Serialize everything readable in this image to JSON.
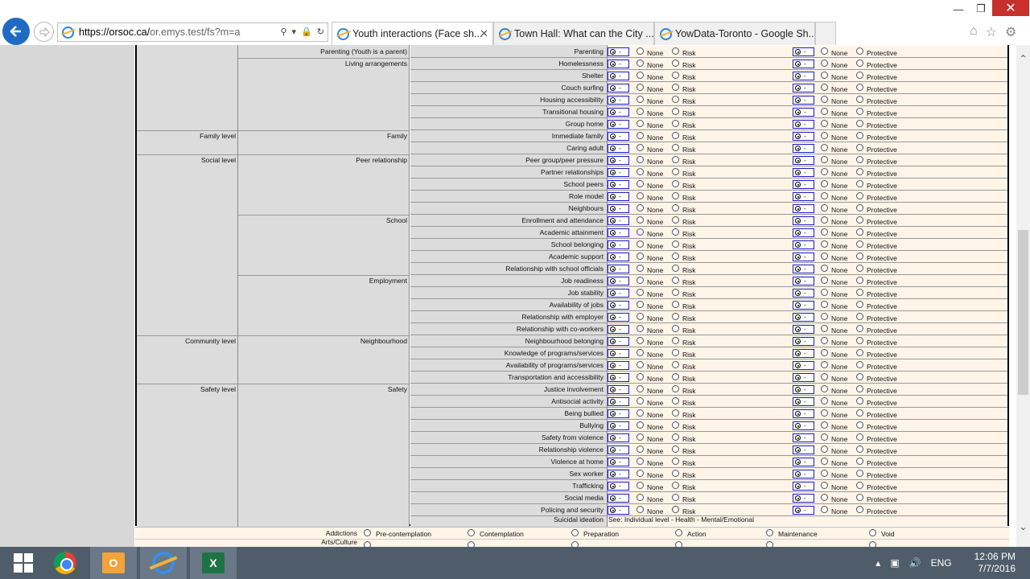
{
  "browser": {
    "window_buttons": {
      "minimize": "—",
      "maximize": "❐",
      "close": "✕"
    },
    "address": {
      "domain": "https://orsoc.ca/",
      "path": "or.emys.test/fs?m=a"
    },
    "address_icons": {
      "search": "⚲",
      "dropdown": "▾",
      "lock": "🔒",
      "refresh": "↻"
    },
    "tabs": [
      {
        "label": "Youth interactions (Face sh...",
        "active": true,
        "close": "✕"
      },
      {
        "label": "Town Hall: What can the City ...",
        "active": false
      },
      {
        "label": "YowData-Toronto - Google Sh...",
        "active": false
      }
    ],
    "toolbar_icons": {
      "home": "⌂",
      "favorites": "☆",
      "settings": "⚙"
    },
    "nav": {
      "back": "←",
      "forward": "⇨"
    }
  },
  "form": {
    "option_labels": {
      "none": "None",
      "risk": "Risk",
      "protective": "Protective"
    },
    "selector_dash": "-",
    "sections": [
      {
        "level": "",
        "category": "Parenting (Youth is a parent)",
        "items": [
          "Parenting"
        ]
      },
      {
        "level": "",
        "category": "Living arrangements",
        "items": [
          "Homelessness",
          "Shelter",
          "Couch surfing",
          "Housing accessibility",
          "Transitional housing",
          "Group home"
        ]
      },
      {
        "level": "Family level",
        "category": "Family",
        "items": [
          "Immediate family",
          "Caring adult"
        ]
      },
      {
        "level": "Social level",
        "category": "Peer relationship",
        "items": [
          "Peer group/peer pressure",
          "Partner relationships",
          "School peers",
          "Role model",
          "Neighbours"
        ]
      },
      {
        "level": "",
        "category": "School",
        "items": [
          "Enrollment and attendance",
          "Academic attainment",
          "School belonging",
          "Academic support",
          "Relationship with school officials"
        ]
      },
      {
        "level": "",
        "category": "Employment",
        "items": [
          "Job readiness",
          "Job stability",
          "Availability of jobs",
          "Relationship with employer",
          "Relationship with co-workers"
        ]
      },
      {
        "level": "Community level",
        "category": "Neighbourhood",
        "items": [
          "Neighbourhood belonging",
          "Knowledge of programs/services",
          "Availability of programs/services",
          "Transportation and accessibility"
        ]
      },
      {
        "level": "Safety level",
        "category": "Safety",
        "items": [
          "Justice involvement",
          "Antisocial activity",
          "Being bullied",
          "Bullying",
          "Safety from violence",
          "Relationship violence",
          "Violence at home",
          "Sex worker",
          "Trafficking",
          "Social media",
          "Policing and security"
        ]
      }
    ],
    "suicidal": {
      "label": "Suicidal ideation",
      "note": "See: Individual level - Health - Mental/Emotional"
    },
    "addictions": {
      "label": "Addictions",
      "stages": [
        "Pre-contemplation",
        "Contemplation",
        "Preparation",
        "Action",
        "Maintenance",
        "Void"
      ]
    },
    "arts_label": "Arts/Culture"
  },
  "scrollbar": {
    "up": "⌃",
    "down": "⌄"
  },
  "taskbar": {
    "apps": [
      "start",
      "chrome",
      "outlook",
      "internet-explorer",
      "excel"
    ],
    "outlook_letter": "O",
    "excel_letter": "X",
    "language": "ENG",
    "tray_icons": {
      "chevron": "▴",
      "network": "▣",
      "volume": "🔊"
    },
    "time": "12:06 PM",
    "date": "7/7/2016"
  }
}
